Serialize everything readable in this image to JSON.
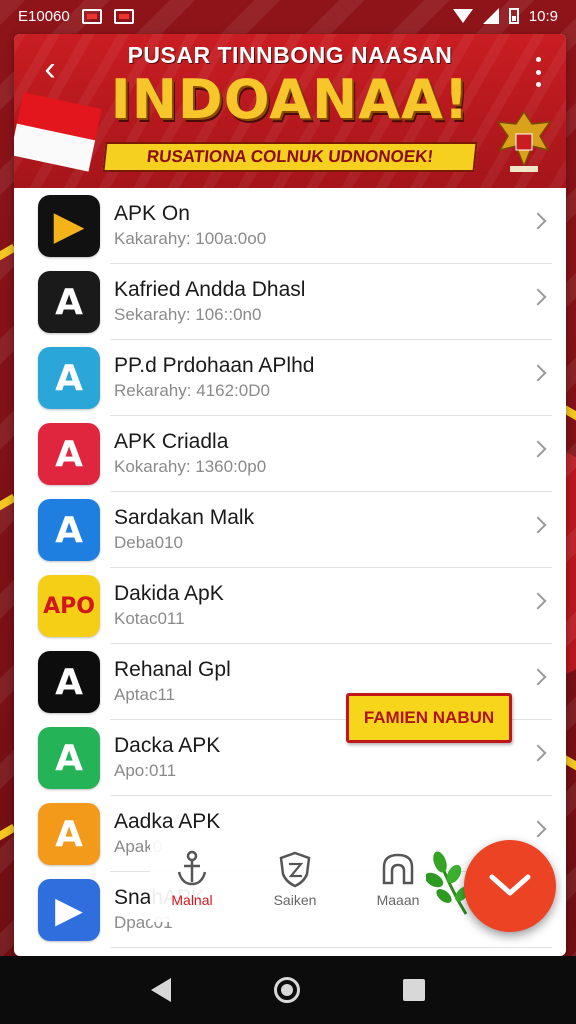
{
  "status_bar": {
    "left_text": "E10060",
    "time": "10:9"
  },
  "banner": {
    "top_text": "PUSAR TINNBONG NAASAN",
    "main_text": "INDOANAA!",
    "strip_text": "RUSATIONA COLNUK UDNONOEK!"
  },
  "apps": [
    {
      "name": "APK On",
      "sub": "Kakarahy: 100a:0o0",
      "icon": "play-triangle",
      "color": "#111111",
      "glyph": "▶"
    },
    {
      "name": "Kafried Andda Dhasl",
      "sub": "Sekarahy: 106::0n0",
      "icon": "letter-a",
      "color": "#1a1a1a",
      "glyph": "A"
    },
    {
      "name": "PP.d Prdohaan APlhd",
      "sub": "Rekarahy: 4162:0D0",
      "icon": "letter-a",
      "color": "#2aa6d9",
      "glyph": "A"
    },
    {
      "name": "APK Criadla",
      "sub": "Kokarahy: 1360:0p0",
      "icon": "letter-a",
      "color": "#e0263f",
      "glyph": "A"
    },
    {
      "name": "Sardakan Malk",
      "sub": "Deba010",
      "icon": "letter-a",
      "color": "#1f7fe0",
      "glyph": "A"
    },
    {
      "name": "Dakida ApK",
      "sub": "Kotac011",
      "icon": "apo-text",
      "color": "#f5cf16",
      "glyph": "APO"
    },
    {
      "name": "Rehanal Gpl",
      "sub": "Aptac11",
      "icon": "letter-a",
      "color": "#0d0d0d",
      "glyph": "A"
    },
    {
      "name": "Dacka APK",
      "sub": "Apo:011",
      "icon": "letter-a",
      "color": "#25b357",
      "glyph": "A"
    },
    {
      "name": "Aadka APK",
      "sub": "Apak0",
      "icon": "letter-a",
      "color": "#f39a1b",
      "glyph": "A"
    },
    {
      "name": "SnahAPK",
      "sub": "Dpac01",
      "icon": "play-store",
      "color": "#2f6fdd",
      "glyph": "▶"
    }
  ],
  "badge": {
    "label": "FAMIEN NABUN"
  },
  "bottom_nav": [
    {
      "label": "Malnal",
      "icon": "anchor-icon",
      "active": true
    },
    {
      "label": "Saiken",
      "icon": "shield-icon",
      "active": false
    },
    {
      "label": "Maaan",
      "icon": "arch-icon",
      "active": false
    }
  ],
  "colors": {
    "accent": "#ec4325",
    "banner_red": "#c91d22",
    "banner_gold": "#f6c62a",
    "background": "#7a1116"
  }
}
